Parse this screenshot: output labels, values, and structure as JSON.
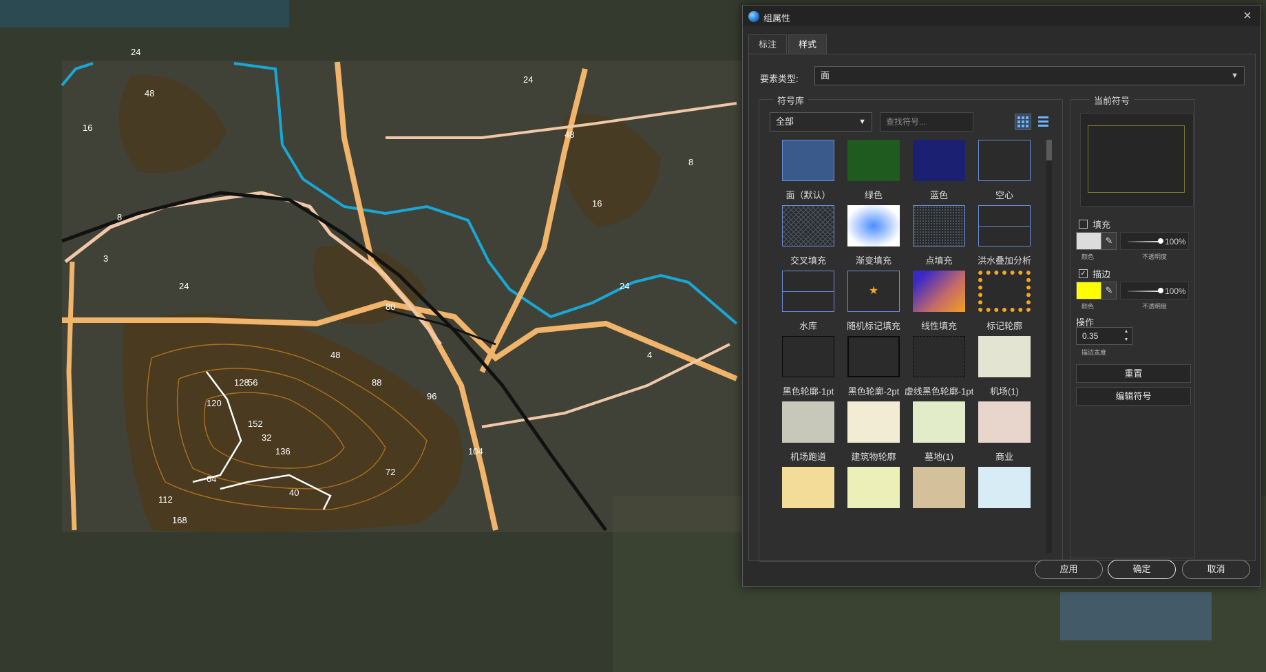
{
  "dialog": {
    "title": "组属性",
    "close_icon": "×",
    "tabs": [
      {
        "label": "标注"
      },
      {
        "label": "样式"
      }
    ],
    "active_tab": "样式",
    "feature_type": {
      "label": "要素类型:",
      "value": "面"
    },
    "symbol_library": {
      "title": "符号库",
      "filter_value": "全部",
      "search_placeholder": "查找符号...",
      "symbols": [
        {
          "label": "面（默认）"
        },
        {
          "label": "绿色"
        },
        {
          "label": "蓝色"
        },
        {
          "label": "空心"
        },
        {
          "label": "交叉填充"
        },
        {
          "label": "渐变填充"
        },
        {
          "label": "点填充"
        },
        {
          "label": "洪水叠加分析"
        },
        {
          "label": "水库"
        },
        {
          "label": "随机标记填充"
        },
        {
          "label": "线性填充"
        },
        {
          "label": "标记轮廓"
        },
        {
          "label": "黑色轮廓-1pt"
        },
        {
          "label": "黑色轮廓-2pt"
        },
        {
          "label": "虚线黑色轮廓-1pt"
        },
        {
          "label": "机场(1)"
        },
        {
          "label": "机场跑道"
        },
        {
          "label": "建筑物轮廓"
        },
        {
          "label": "墓地(1)"
        },
        {
          "label": "商业"
        },
        {
          "label": ""
        },
        {
          "label": ""
        },
        {
          "label": ""
        },
        {
          "label": ""
        }
      ],
      "swatch_colors": [
        "#3a5a8c",
        "#1f5a1e",
        "#1c2072",
        "#2b2b2b",
        "#2b2b2b",
        "#9fd0ff",
        "#2b2b2b",
        "#2b2b2b",
        "#2b2b2b",
        "#2b2b2b",
        "#3b28c8",
        "#2b2b2b",
        "#2b2b2b",
        "#2b2b2b",
        "#2b2b2b",
        "#e4e4d2",
        "#c8c8ba",
        "#f2ecd4",
        "#e2ecc8",
        "#e8d6cc",
        "#f2dc98",
        "#ecf0b8",
        "#d4c09a",
        "#d8ecf6"
      ]
    },
    "current_symbol": {
      "title": "当前符号",
      "fill": {
        "label": "填充",
        "checked": false,
        "color": "#dcdcdc",
        "color_caption": "颜色",
        "opacity": "100%",
        "opacity_caption": "不透明度"
      },
      "stroke": {
        "label": "描边",
        "checked": true,
        "color": "#ffff00",
        "color_caption": "颜色",
        "opacity": "100%",
        "opacity_caption": "不透明度"
      },
      "operation_label": "操作",
      "stroke_width": "0.35",
      "stroke_width_caption": "描边宽度",
      "reset_label": "重置",
      "edit_label": "编辑符号"
    },
    "buttons": {
      "apply": "应用",
      "ok": "确定",
      "cancel": "取消"
    }
  },
  "map": {
    "contour_labels": [
      "24",
      "48",
      "8",
      "16",
      "24",
      "32",
      "40",
      "48",
      "56",
      "64",
      "72",
      "80",
      "88",
      "96",
      "104",
      "112",
      "120",
      "128",
      "136",
      "152",
      "168",
      "3",
      "4"
    ]
  },
  "colors": {
    "map_bg": "#343a2e",
    "terrain": "#4a3a1e",
    "arterial": "#f0b46a",
    "secondary": "#f0c8a8",
    "river": "#18a8d8",
    "rail": "#111111",
    "contour": "#c8801a"
  }
}
